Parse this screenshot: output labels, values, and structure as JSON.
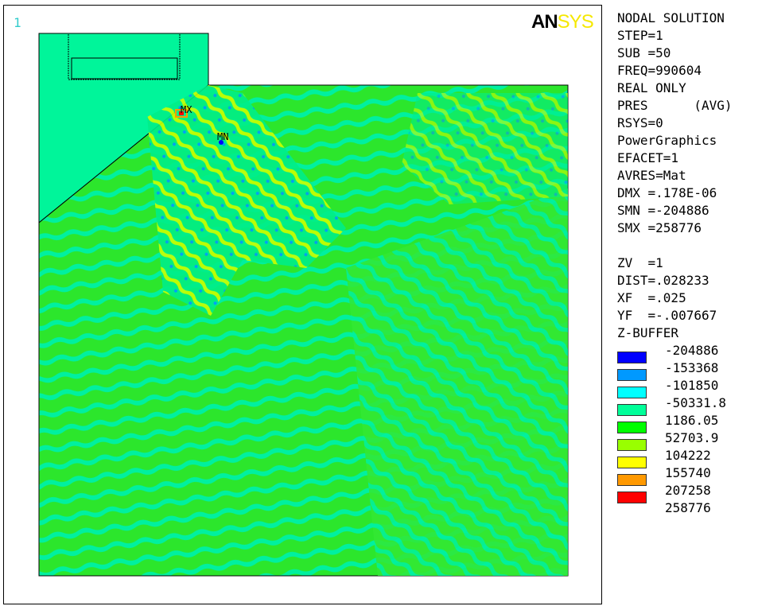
{
  "window_number": "1",
  "logo": {
    "text_dark": "AN",
    "text_light": "SYS",
    "color_dark": "#000000",
    "color_light": "#ffff00"
  },
  "info": {
    "lines": [
      "NODAL SOLUTION",
      "STEP=1",
      "SUB =50",
      "FREQ=990604",
      "REAL ONLY",
      "PRES      (AVG)",
      "RSYS=0",
      "PowerGraphics",
      "EFACET=1",
      "AVRES=Mat",
      "DMX =.178E-06",
      "SMN =-204886",
      "SMX =258776"
    ]
  },
  "view": {
    "lines": [
      "ZV  =1",
      "DIST=.028233",
      "XF  =.025",
      "YF  =-.007667",
      "Z-BUFFER"
    ]
  },
  "legend": {
    "values": [
      "-204886",
      "-153368",
      "-101850",
      "-50331.8",
      "1186.05",
      "52703.9",
      "104222",
      "155740",
      "207258",
      "258776"
    ],
    "colors": [
      "#0000ff",
      "#0099ff",
      "#00ffff",
      "#00ff99",
      "#00ff00",
      "#99ff00",
      "#ffff00",
      "#ff9900",
      "#ff0000"
    ]
  },
  "plot": {
    "max_label": "MX",
    "min_label": "MN",
    "model_fill": "#00ff99",
    "field_base": "#33ee33"
  }
}
